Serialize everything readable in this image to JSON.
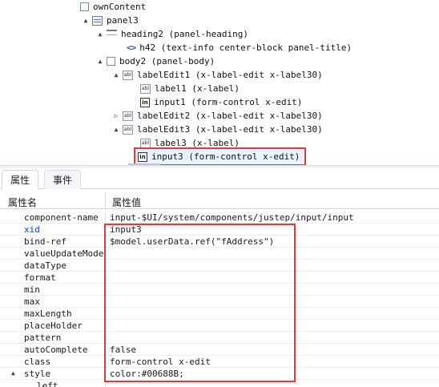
{
  "tree": {
    "nodes": [
      {
        "label": "ownContent",
        "icon": "box-icon",
        "twisty": ""
      },
      {
        "label": "panel3",
        "icon": "panel-icon",
        "twisty": "▲"
      },
      {
        "label": "heading2 (panel-heading)",
        "icon": "heading-icon",
        "twisty": "▲"
      },
      {
        "label": "h42 (text-info center-block panel-title)",
        "icon": "code-icon",
        "twisty": ""
      },
      {
        "label": "body2 (panel-body)",
        "icon": "box-icon",
        "twisty": "▲"
      },
      {
        "label": "labelEdit1 (x-label-edit x-label30)",
        "icon": "label-edit-icon",
        "twisty": "▲"
      },
      {
        "label": "label1 (x-label)",
        "icon": "label-icon",
        "twisty": ""
      },
      {
        "label": "input1 (form-control x-edit)",
        "icon": "input-icon",
        "twisty": ""
      },
      {
        "label": "labelEdit2 (x-label-edit x-label30)",
        "icon": "label-edit-icon",
        "twisty": "▷"
      },
      {
        "label": "labelEdit3 (x-label-edit x-label30)",
        "icon": "label-edit-icon",
        "twisty": "▲"
      },
      {
        "label": "label3 (x-label)",
        "icon": "label-icon",
        "twisty": ""
      },
      {
        "label": "input3 (form-control x-edit)",
        "icon": "input-icon",
        "twisty": ""
      }
    ]
  },
  "tabs": {
    "properties": "属性",
    "events": "事件"
  },
  "grid": {
    "header_name": "属性名",
    "header_value": "属性值",
    "rows": [
      {
        "name": "component-name",
        "value": "input-$UI/system/components/justep/input/input"
      },
      {
        "name": "xid",
        "value": "input3"
      },
      {
        "name": "bind-ref",
        "value": "$model.userData.ref(\"fAddress\")"
      },
      {
        "name": "valueUpdateMode",
        "value": ""
      },
      {
        "name": "dataType",
        "value": ""
      },
      {
        "name": "format",
        "value": ""
      },
      {
        "name": "min",
        "value": ""
      },
      {
        "name": "max",
        "value": ""
      },
      {
        "name": "maxLength",
        "value": ""
      },
      {
        "name": "placeHolder",
        "value": ""
      },
      {
        "name": "pattern",
        "value": ""
      },
      {
        "name": "autoComplete",
        "value": "false"
      },
      {
        "name": "class",
        "value": "form-control x-edit"
      },
      {
        "name": "style",
        "value": "color:#00688B;"
      },
      {
        "name": "left",
        "value": ""
      }
    ]
  },
  "icons": {
    "label_abbr": "abl",
    "input_abbr": "in",
    "code_glyph": "<>"
  },
  "colors": {
    "highlight": "#e23b3b",
    "xid_name": "#1a3fc4",
    "selection_bg": "#eaf1fb"
  }
}
